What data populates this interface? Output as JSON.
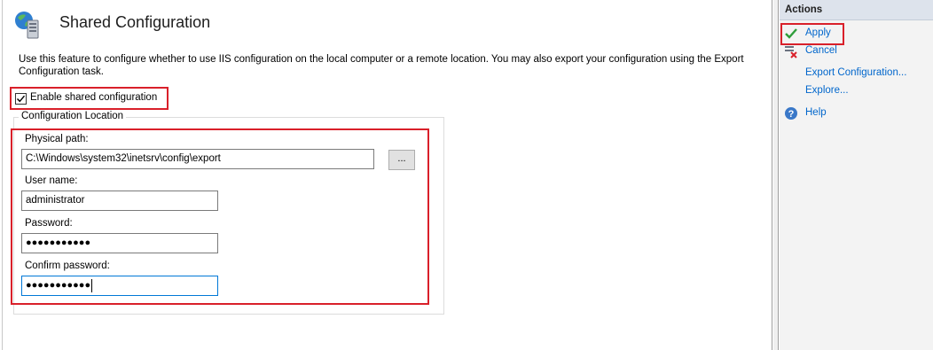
{
  "page": {
    "title": "Shared Configuration",
    "description": "Use this feature to configure whether to use IIS configuration on the local computer or a remote location. You may also export your configuration using the Export Configuration task."
  },
  "enable_shared": {
    "label": "Enable shared configuration",
    "checked": true
  },
  "config_location": {
    "legend": "Configuration Location",
    "physical_path": {
      "label": "Physical path:",
      "value": "C:\\Windows\\system32\\inetsrv\\config\\export"
    },
    "browse_label": "...",
    "user_name": {
      "label": "User name:",
      "value": "administrator"
    },
    "password": {
      "label": "Password:",
      "value": "●●●●●●●●●●●"
    },
    "confirm_password": {
      "label": "Confirm password:",
      "value": "●●●●●●●●●●●"
    }
  },
  "actions": {
    "header": "Actions",
    "items": [
      {
        "label": "Apply",
        "icon": "check-icon"
      },
      {
        "label": "Cancel",
        "icon": "cancel-icon"
      },
      {
        "label": "Export Configuration...",
        "icon": "none"
      },
      {
        "label": "Explore...",
        "icon": "none"
      },
      {
        "label": "Help",
        "icon": "help-icon"
      }
    ]
  },
  "colors": {
    "highlight": "#d9202a",
    "link": "#0066cc",
    "actions_header": "#dde3ec"
  }
}
